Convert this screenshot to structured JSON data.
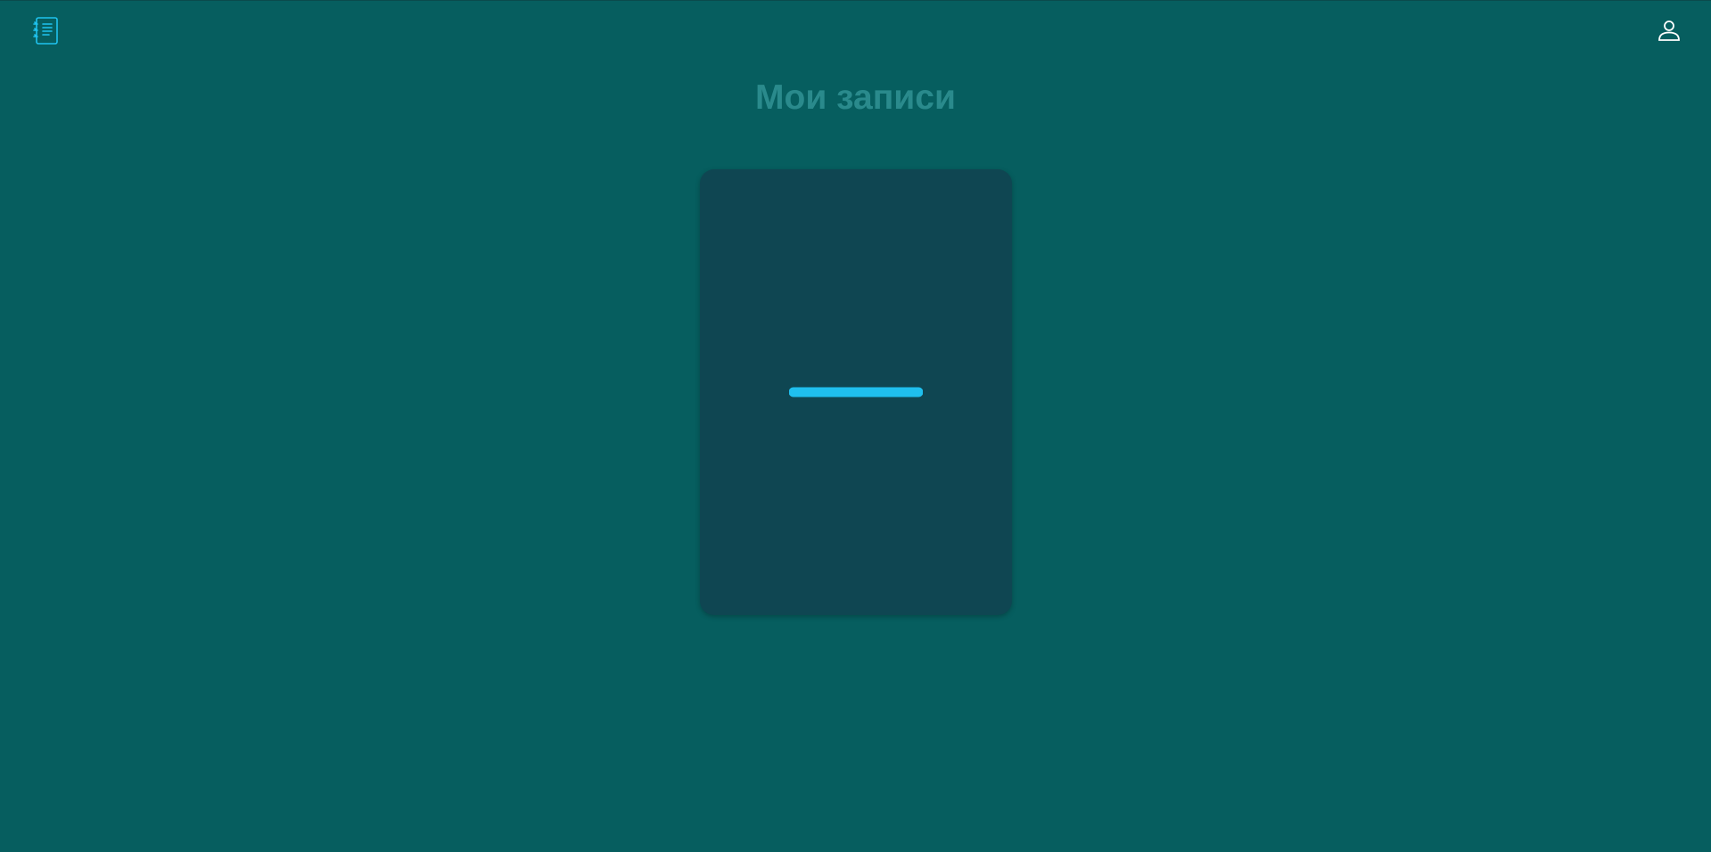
{
  "header": {
    "logo_icon": "notebook-icon",
    "profile_icon": "user-icon"
  },
  "main": {
    "title": "Мои записи",
    "add_card_icon": "plus-icon"
  },
  "colors": {
    "background": "#065e5f",
    "title": "#2a8a8c",
    "card": "#0f4652",
    "accent": "#1fc3ef",
    "profile_icon": "#ffffff"
  }
}
